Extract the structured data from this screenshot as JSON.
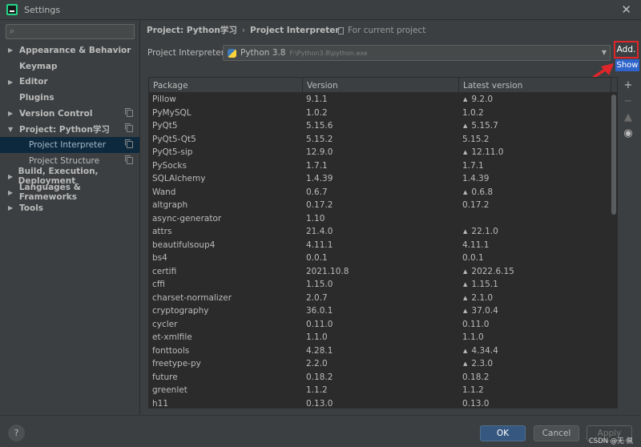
{
  "window": {
    "title": "Settings",
    "close_glyph": "✕"
  },
  "sidebar": {
    "search_placeholder": "",
    "items": [
      {
        "label": "Appearance & Behavior",
        "arrow": "▶"
      },
      {
        "label": "Keymap"
      },
      {
        "label": "Editor",
        "arrow": "▶"
      },
      {
        "label": "Plugins"
      },
      {
        "label": "Version Control",
        "arrow": "▶"
      },
      {
        "label": "Project: Python学习",
        "arrow": "▼"
      },
      {
        "label": "Project Interpreter",
        "selected": true
      },
      {
        "label": "Project Structure"
      },
      {
        "label": "Build, Execution, Deployment",
        "arrow": "▶"
      },
      {
        "label": "Languages & Frameworks",
        "arrow": "▶"
      },
      {
        "label": "Tools",
        "arrow": "▶"
      }
    ]
  },
  "breadcrumb": {
    "project": "Project: Python学习",
    "sep": "›",
    "page": "Project Interpreter"
  },
  "for_current_project": "For current project",
  "interpreter": {
    "label": "Project Interpreter:",
    "name": "Python 3.8",
    "path": "F:\\Python3.8\\python.exe",
    "arrow": "▼"
  },
  "add_button": "Add.",
  "show_tooltip": "Show",
  "table": {
    "headers": [
      "Package",
      "Version",
      "Latest version"
    ],
    "rows": [
      {
        "package": "Pillow",
        "version": "9.1.1",
        "latest": "9.2.0",
        "upgrade": true
      },
      {
        "package": "PyMySQL",
        "version": "1.0.2",
        "latest": "1.0.2",
        "upgrade": false
      },
      {
        "package": "PyQt5",
        "version": "5.15.6",
        "latest": "5.15.7",
        "upgrade": true
      },
      {
        "package": "PyQt5-Qt5",
        "version": "5.15.2",
        "latest": "5.15.2",
        "upgrade": false
      },
      {
        "package": "PyQt5-sip",
        "version": "12.9.0",
        "latest": "12.11.0",
        "upgrade": true
      },
      {
        "package": "PySocks",
        "version": "1.7.1",
        "latest": "1.7.1",
        "upgrade": false
      },
      {
        "package": "SQLAlchemy",
        "version": "1.4.39",
        "latest": "1.4.39",
        "upgrade": false
      },
      {
        "package": "Wand",
        "version": "0.6.7",
        "latest": "0.6.8",
        "upgrade": true
      },
      {
        "package": "altgraph",
        "version": "0.17.2",
        "latest": "0.17.2",
        "upgrade": false
      },
      {
        "package": "async-generator",
        "version": "1.10",
        "latest": "",
        "upgrade": false
      },
      {
        "package": "attrs",
        "version": "21.4.0",
        "latest": "22.1.0",
        "upgrade": true
      },
      {
        "package": "beautifulsoup4",
        "version": "4.11.1",
        "latest": "4.11.1",
        "upgrade": false
      },
      {
        "package": "bs4",
        "version": "0.0.1",
        "latest": "0.0.1",
        "upgrade": false
      },
      {
        "package": "certifi",
        "version": "2021.10.8",
        "latest": "2022.6.15",
        "upgrade": true
      },
      {
        "package": "cffi",
        "version": "1.15.0",
        "latest": "1.15.1",
        "upgrade": true
      },
      {
        "package": "charset-normalizer",
        "version": "2.0.7",
        "latest": "2.1.0",
        "upgrade": true
      },
      {
        "package": "cryptography",
        "version": "36.0.1",
        "latest": "37.0.4",
        "upgrade": true
      },
      {
        "package": "cycler",
        "version": "0.11.0",
        "latest": "0.11.0",
        "upgrade": false
      },
      {
        "package": "et-xmlfile",
        "version": "1.1.0",
        "latest": "1.1.0",
        "upgrade": false
      },
      {
        "package": "fonttools",
        "version": "4.28.1",
        "latest": "4.34.4",
        "upgrade": true
      },
      {
        "package": "freetype-py",
        "version": "2.2.0",
        "latest": "2.3.0",
        "upgrade": true
      },
      {
        "package": "future",
        "version": "0.18.2",
        "latest": "0.18.2",
        "upgrade": false
      },
      {
        "package": "greenlet",
        "version": "1.1.2",
        "latest": "1.1.2",
        "upgrade": false
      },
      {
        "package": "h11",
        "version": "0.13.0",
        "latest": "0.13.0",
        "upgrade": false
      }
    ]
  },
  "tools": {
    "add": "+",
    "remove": "−",
    "upgrade": "▲",
    "show_early": "◉"
  },
  "footer": {
    "help": "?",
    "ok": "OK",
    "cancel": "Cancel",
    "apply": "Apply",
    "watermark": "CSDN @无 佩"
  },
  "colors": {
    "accent_red": "#e0262a",
    "selection": "#0d293e",
    "ok_blue": "#365880",
    "tooltip_blue": "#2f65ca"
  }
}
